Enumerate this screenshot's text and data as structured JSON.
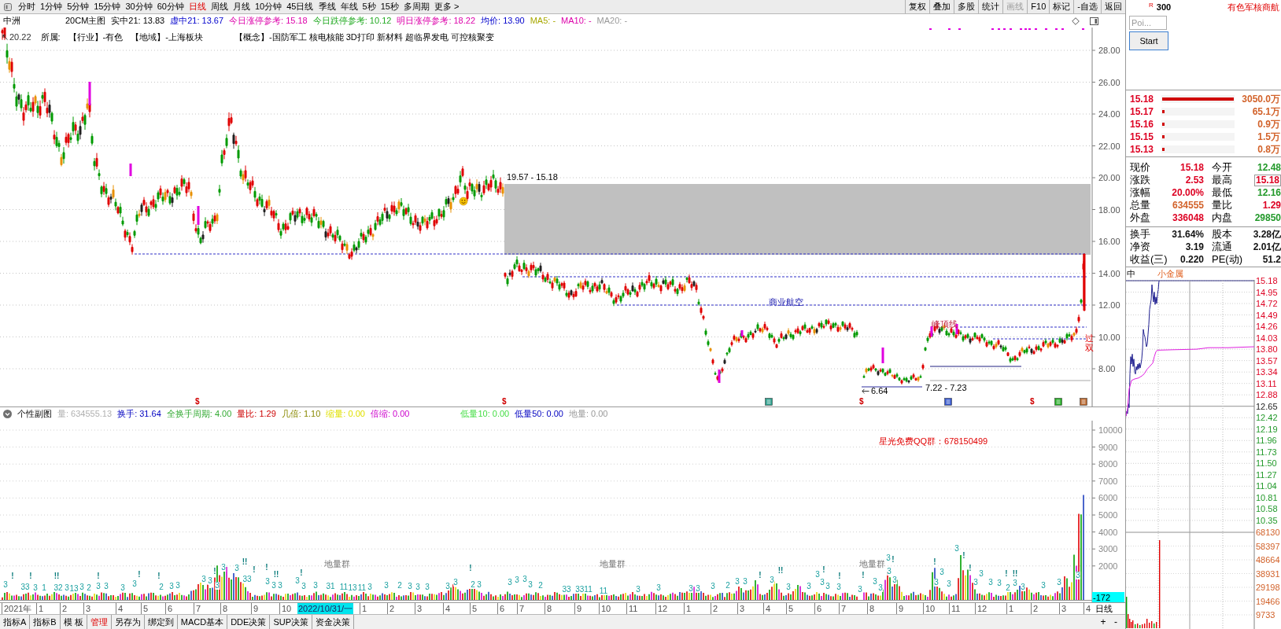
{
  "toolbar": {
    "periods": [
      {
        "label": "分时",
        "selected": false
      },
      {
        "label": "1分钟",
        "selected": false
      },
      {
        "label": "5分钟",
        "selected": false
      },
      {
        "label": "15分钟",
        "selected": false
      },
      {
        "label": "30分钟",
        "selected": false
      },
      {
        "label": "60分钟",
        "selected": false
      },
      {
        "label": "日线",
        "selected": true
      },
      {
        "label": "周线",
        "selected": false
      },
      {
        "label": "月线",
        "selected": false
      },
      {
        "label": "10分钟",
        "selected": false
      },
      {
        "label": "45日线",
        "selected": false
      },
      {
        "label": "季线",
        "selected": false
      },
      {
        "label": "年线",
        "selected": false
      },
      {
        "label": "5秒",
        "selected": false
      },
      {
        "label": "15秒",
        "selected": false
      },
      {
        "label": "多周期",
        "selected": false
      },
      {
        "label": "更多 >",
        "selected": false
      }
    ],
    "buttons": [
      {
        "label": "复权",
        "disabled": false
      },
      {
        "label": "叠加",
        "disabled": false
      },
      {
        "label": "多股",
        "disabled": false
      },
      {
        "label": "统计",
        "disabled": false
      },
      {
        "label": "画线",
        "disabled": true
      },
      {
        "label": "F10",
        "disabled": false
      },
      {
        "label": "标记",
        "disabled": false
      },
      {
        "label": "-自选",
        "disabled": false
      },
      {
        "label": "返回",
        "disabled": false
      }
    ]
  },
  "info_bar": {
    "stock_name": "中洲",
    "items": [
      {
        "kind": "title",
        "text": "20CM主图"
      },
      {
        "kind": "plain",
        "text": "实中21: 13.83"
      },
      {
        "kind": "virtual",
        "text": "虚中21: 13.67"
      },
      {
        "kind": "limit",
        "text": "今日涨停参考: 15.18"
      },
      {
        "kind": "floor",
        "text": "今日跌停参考: 10.12"
      },
      {
        "kind": "limit",
        "text": "明日涨停参考: 18.22"
      },
      {
        "kind": "average",
        "text": "均价: 13.90"
      },
      {
        "kind": "ma5",
        "text": "MA5: -"
      },
      {
        "kind": "ma10",
        "text": "MA10: -"
      },
      {
        "kind": "ma20",
        "text": "MA20: -"
      }
    ]
  },
  "main_chart": {
    "high_marker": "20.22",
    "tags_label": "所属:",
    "tags": [
      "【行业】-有色",
      "【地域】-上海板块",
      "【概念】-国防军工 核电核能 3D打印 新材料 超临界发电 可控核聚变"
    ],
    "y_axis": [
      "28.00",
      "26.00",
      "24.00",
      "22.00",
      "20.00",
      "18.00",
      "16.00",
      "14.00",
      "12.00",
      "10.00",
      "8.00"
    ],
    "annotations": [
      {
        "kind": "range",
        "text": "19.57 - 15.18"
      },
      {
        "kind": "label",
        "text": "商业航空"
      },
      {
        "kind": "peak",
        "text": "峰顶线"
      },
      {
        "kind": "low",
        "text": "6.64"
      },
      {
        "kind": "range",
        "text": "7.22 - 7.23"
      },
      {
        "kind": "vertical",
        "text": "过双"
      }
    ],
    "markers": [
      {
        "kind": "dollar",
        "symbol": "$"
      },
      {
        "kind": "dollar",
        "symbol": "$"
      },
      {
        "kind": "event",
        "color": "#2a9d8a"
      },
      {
        "kind": "dollar",
        "symbol": "$"
      },
      {
        "kind": "event",
        "color": "#3355cc"
      },
      {
        "kind": "dollar",
        "symbol": "$"
      },
      {
        "kind": "event",
        "color": "#22aa22"
      },
      {
        "kind": "event",
        "color": "#b8642a"
      }
    ]
  },
  "sub_chart": {
    "title": "个性副图",
    "items": [
      {
        "kind": "volume",
        "text": "量: 634555.13"
      },
      {
        "kind": "turnover",
        "text": "换手: 31.64"
      },
      {
        "kind": "cycle",
        "text": "全换手周期: 4.00"
      },
      {
        "kind": "ratio",
        "text": "量比: 1.29"
      },
      {
        "kind": "multiple",
        "text": "几倍: 1.10"
      },
      {
        "kind": "shrink",
        "text": "缩量: 0.00"
      },
      {
        "kind": "shrink_ratio",
        "text": "倍缩: 0.00"
      },
      {
        "kind": "low10",
        "text": "低量10: 0.00"
      },
      {
        "kind": "low50",
        "text": "低量50: 0.00"
      },
      {
        "kind": "lowest",
        "text": "地量: 0.00"
      }
    ],
    "notice": "星光免费QQ群：678150499",
    "cluster_labels": [
      "地量群",
      "地量群",
      "地量群"
    ],
    "count_labels": [
      "3",
      "33",
      "3",
      "1",
      "32",
      "3",
      "13",
      "3",
      "2",
      "3",
      "3",
      "3",
      "3",
      "2",
      "3",
      "3",
      "3",
      "3",
      "3",
      "3",
      "3",
      "33",
      "3",
      "3",
      "3",
      "3",
      "3",
      "3",
      "31",
      "11",
      "13",
      "11",
      "3",
      "3",
      "2",
      "3",
      "3",
      "3",
      "3",
      "3",
      "2",
      "3",
      "3",
      "3",
      "3",
      "3",
      "2",
      "33",
      "3311",
      "11",
      "3",
      "3",
      "3",
      "3",
      "3",
      "2",
      "3",
      "3",
      "3",
      "3",
      "3",
      "3",
      "3",
      "3",
      "3",
      "3",
      "3",
      "3",
      "3",
      "3",
      "3",
      "3",
      "3",
      "3",
      "3",
      "3",
      "3",
      "3",
      "3",
      "2",
      "3",
      "3",
      "3",
      "3",
      "3"
    ],
    "alert_marks": [
      "!",
      "!",
      "!!",
      "!",
      "!",
      "!",
      "!",
      "!!",
      "!",
      "!",
      "!!",
      "!",
      "!",
      "!",
      "!!",
      "!",
      "!",
      "!",
      "!",
      "!",
      "!",
      "!",
      "!",
      "!!"
    ],
    "y_axis": [
      "10000",
      "9000",
      "8000",
      "7000",
      "6000",
      "5000",
      "4000",
      "3000",
      "2000"
    ],
    "cursor_value": "-172"
  },
  "date_axis": {
    "labels": [
      {
        "text": "2021年",
        "selected": false
      },
      {
        "text": "1",
        "selected": false
      },
      {
        "text": "2",
        "selected": false
      },
      {
        "text": "3",
        "selected": false
      },
      {
        "text": "4",
        "selected": false
      },
      {
        "text": "5",
        "selected": false
      },
      {
        "text": "6",
        "selected": false
      },
      {
        "text": "7",
        "selected": false
      },
      {
        "text": "8",
        "selected": false
      },
      {
        "text": "9",
        "selected": false
      },
      {
        "text": "10",
        "selected": false
      },
      {
        "text": "2022/10/31/一",
        "selected": true
      },
      {
        "text": "1",
        "selected": false
      },
      {
        "text": "2",
        "selected": false
      },
      {
        "text": "3",
        "selected": false
      },
      {
        "text": "4",
        "selected": false
      },
      {
        "text": "5",
        "selected": false
      },
      {
        "text": "6",
        "selected": false
      },
      {
        "text": "7",
        "selected": false
      },
      {
        "text": "8",
        "selected": false
      },
      {
        "text": "9",
        "selected": false
      },
      {
        "text": "10",
        "selected": false
      },
      {
        "text": "11",
        "selected": false
      },
      {
        "text": "12",
        "selected": false
      },
      {
        "text": "1",
        "selected": false
      },
      {
        "text": "2",
        "selected": false
      },
      {
        "text": "3",
        "selected": false
      },
      {
        "text": "4",
        "selected": false
      },
      {
        "text": "5",
        "selected": false
      },
      {
        "text": "6",
        "selected": false
      },
      {
        "text": "7",
        "selected": false
      },
      {
        "text": "8",
        "selected": false
      },
      {
        "text": "9",
        "selected": false
      },
      {
        "text": "10",
        "selected": false
      },
      {
        "text": "11",
        "selected": false
      },
      {
        "text": "12",
        "selected": false
      },
      {
        "text": "1",
        "selected": false
      },
      {
        "text": "2",
        "selected": false
      },
      {
        "text": "3",
        "selected": false
      },
      {
        "text": "4",
        "selected": false
      }
    ],
    "period": "日线"
  },
  "bottom_bar": {
    "tabs": [
      {
        "label": "指标A",
        "selected": false
      },
      {
        "label": "指标B",
        "selected": false
      },
      {
        "label": "模 板",
        "selected": false
      },
      {
        "label": "管理",
        "selected": true
      },
      {
        "label": "另存为",
        "selected": false
      },
      {
        "label": "绑定到",
        "selected": false
      },
      {
        "label": "MACD基本",
        "selected": false
      },
      {
        "label": "DDE决策",
        "selected": false
      },
      {
        "label": "SUP决策",
        "selected": false
      },
      {
        "label": "资金决策",
        "selected": false
      }
    ],
    "zoom_buttons": [
      "+",
      "-"
    ]
  },
  "quote_panel": {
    "exchange_mark": "R",
    "code": "300",
    "sector": "有色军核商航",
    "tool": {
      "placeholder": "Poi...",
      "button": "Start"
    },
    "order_book": [
      {
        "price": "15.18",
        "level": 1,
        "volume": "3050.0万"
      },
      {
        "price": "15.17",
        "level": 0.03,
        "volume": "65.1万"
      },
      {
        "price": "15.16",
        "level": 0.03,
        "volume": "0.9万"
      },
      {
        "price": "15.15",
        "level": 0.03,
        "volume": "1.5万"
      },
      {
        "price": "15.13",
        "level": 0.03,
        "volume": "0.8万"
      }
    ],
    "stats": [
      [
        {
          "label": "现价",
          "value": "15.18",
          "color": "#dd0022",
          "boxed": false
        },
        {
          "label": "今开",
          "value": "12.48",
          "color": "#22992a",
          "boxed": false
        }
      ],
      [
        {
          "label": "涨跌",
          "value": "2.53",
          "color": "#dd0022",
          "boxed": false
        },
        {
          "label": "最高",
          "value": "15.18",
          "color": "#dd0022",
          "boxed": true
        }
      ],
      [
        {
          "label": "涨幅",
          "value": "20.00%",
          "color": "#dd0022",
          "boxed": false
        },
        {
          "label": "最低",
          "value": "12.16",
          "color": "#22992a",
          "boxed": false
        }
      ],
      [
        {
          "label": "总量",
          "value": "634555",
          "color": "#d2622a",
          "boxed": false
        },
        {
          "label": "量比",
          "value": "1.29",
          "color": "#dd0022",
          "boxed": false
        }
      ],
      [
        {
          "label": "外盘",
          "value": "336048",
          "color": "#dd0022",
          "boxed": false
        },
        {
          "label": "内盘",
          "value": "29850",
          "color": "#22992a",
          "boxed": false
        }
      ]
    ],
    "stats_2": [
      [
        {
          "label": "换手",
          "value": "31.64%"
        },
        {
          "label": "股本",
          "value": "3.28亿"
        }
      ],
      [
        {
          "label": "净资",
          "value": "3.19"
        },
        {
          "label": "流通",
          "value": "2.01亿"
        }
      ],
      [
        {
          "label": "收益(三)",
          "value": "0.220"
        },
        {
          "label": "PE(动)",
          "value": "51.2"
        }
      ]
    ],
    "mini_chart": {
      "title": "中",
      "sector": "小金属",
      "price_axis": [
        {
          "text": "15.18",
          "color": "#dd0022"
        },
        {
          "text": "14.95",
          "color": "#dd0022"
        },
        {
          "text": "14.72",
          "color": "#dd0022"
        },
        {
          "text": "14.49",
          "color": "#dd0022"
        },
        {
          "text": "14.26",
          "color": "#dd0022"
        },
        {
          "text": "14.03",
          "color": "#dd0022"
        },
        {
          "text": "13.80",
          "color": "#dd0022"
        },
        {
          "text": "13.57",
          "color": "#dd0022"
        },
        {
          "text": "13.34",
          "color": "#dd0022"
        },
        {
          "text": "13.11",
          "color": "#dd0022"
        },
        {
          "text": "12.88",
          "color": "#dd0022"
        },
        {
          "text": "12.65",
          "color": "#222222"
        },
        {
          "text": "12.42",
          "color": "#22992a"
        },
        {
          "text": "12.19",
          "color": "#22992a"
        },
        {
          "text": "11.96",
          "color": "#22992a"
        },
        {
          "text": "11.73",
          "color": "#22992a"
        },
        {
          "text": "11.50",
          "color": "#22992a"
        },
        {
          "text": "11.27",
          "color": "#22992a"
        },
        {
          "text": "11.04",
          "color": "#22992a"
        },
        {
          "text": "10.81",
          "color": "#22992a"
        },
        {
          "text": "10.58",
          "color": "#22992a"
        },
        {
          "text": "10.35",
          "color": "#22992a"
        }
      ],
      "volume_axis": [
        "68130",
        "58397",
        "48664",
        "38931",
        "29198",
        "19466",
        "9733"
      ]
    }
  }
}
